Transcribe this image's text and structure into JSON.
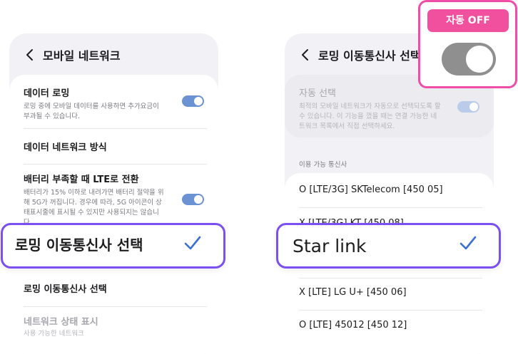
{
  "left": {
    "title": "모바일 네트워크",
    "data_roaming": {
      "title": "데이터 로밍",
      "subtitle": "로밍 중에 모바일 데이터를 사용하면 추가요금이 부과될 수 있습니다."
    },
    "network_mode": {
      "title": "데이터 네트워크 방식"
    },
    "battery_lte": {
      "title": "배터리 부족할 때 LTE로 전환",
      "subtitle": "배터리가 15% 이하로 내려가면 배터리 절약을 위해 5G가 꺼집니다. 경우에 따라, 5G 아이콘이 상태표시줄에 표시될 수 있지만 사용되지는 않습니다."
    },
    "highlight_label": "로밍 이동통신사 선택",
    "roaming_carrier": {
      "title": "로밍 이동통신사 선택"
    },
    "network_status": {
      "title": "네트워크 상태 표시",
      "subtitle": "사용 가능한 네트워크"
    }
  },
  "right": {
    "title": "로밍 이동통신사 선택",
    "auto_select": {
      "title": "자동 선택",
      "subtitle": "최적의 모바일 네트워크가 자동으로 선택되도록 할 수 있습니다. 이 기능을 껐을 때는 연결 가능한 네트워크 목록에서 직접 선택하세요."
    },
    "section_label": "이용 가능 통신사",
    "carriers": [
      "O [LTE/3G] SKTelecom [450 05]",
      "X [LTE/3G] KT [450 08]",
      "X [LTE] LG U+ [450 06]",
      "O [LTE] 45012 [450 12]"
    ],
    "highlight_label": "Star link"
  },
  "callout": {
    "badge": "자동 OFF",
    "toggle_state": "off"
  },
  "colors": {
    "highlight_border": "#7c4ff0",
    "callout_border": "#ef4da8",
    "badge_bg": "#f0509e",
    "toggle_on": "#6b93d3",
    "check": "#3b6fd4"
  }
}
